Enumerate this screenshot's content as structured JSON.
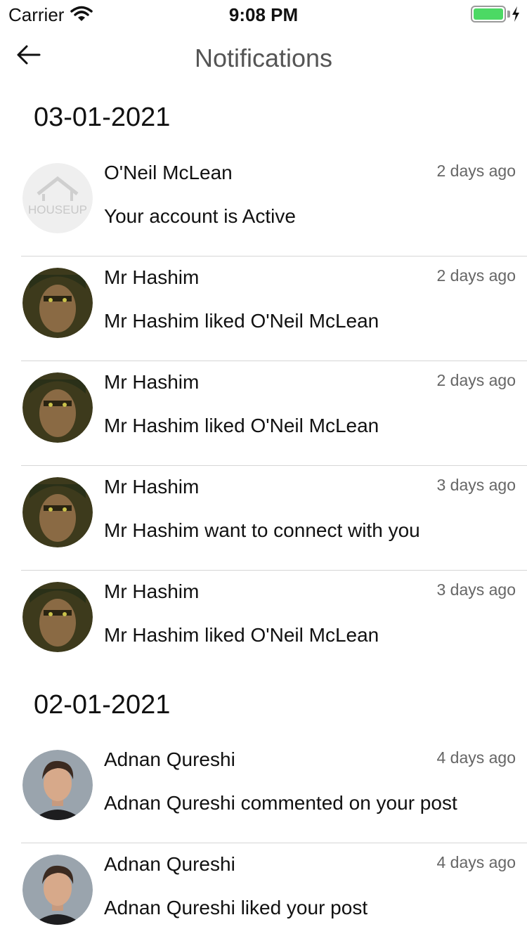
{
  "status_bar": {
    "carrier": "Carrier",
    "time": "9:08 PM",
    "battery_level": 1.0,
    "battery_color": "#4cd964"
  },
  "nav": {
    "title": "Notifications",
    "back_icon": "arrow-left-icon"
  },
  "sections": [
    {
      "date": "03-01-2021",
      "items": [
        {
          "name": "O'Neil McLean",
          "message": "Your account is Active",
          "time": "2 days ago",
          "avatar": "houseup-logo",
          "avatar_logo_text": "HOUSEUP"
        },
        {
          "name": "Mr Hashim",
          "message": "Mr Hashim liked O'Neil McLean",
          "time": "2 days ago",
          "avatar": "user-photo-hashim"
        },
        {
          "name": "Mr Hashim",
          "message": "Mr Hashim liked O'Neil McLean",
          "time": "2 days ago",
          "avatar": "user-photo-hashim"
        },
        {
          "name": "Mr Hashim",
          "message": "Mr Hashim want to connect with you",
          "time": "3 days ago",
          "avatar": "user-photo-hashim"
        },
        {
          "name": "Mr Hashim",
          "message": "Mr Hashim liked O'Neil McLean",
          "time": "3 days ago",
          "avatar": "user-photo-hashim"
        }
      ]
    },
    {
      "date": "02-01-2021",
      "items": [
        {
          "name": "Adnan Qureshi",
          "message": "Adnan Qureshi commented on your post",
          "time": "4 days ago",
          "avatar": "user-photo-adnan"
        },
        {
          "name": "Adnan Qureshi",
          "message": "Adnan Qureshi liked your post",
          "time": "4 days ago",
          "avatar": "user-photo-adnan"
        }
      ]
    }
  ]
}
